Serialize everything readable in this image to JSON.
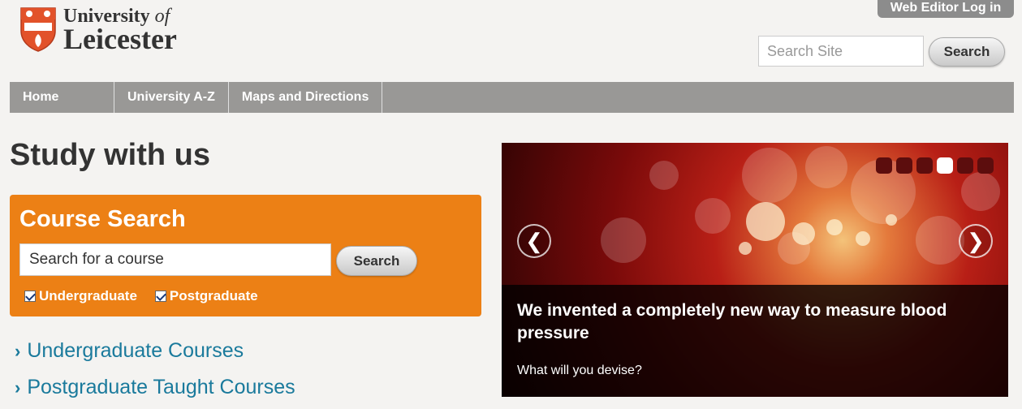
{
  "header": {
    "logo_line1": "University",
    "logo_of": "of",
    "logo_line2": "Leicester",
    "editor_login": "Web Editor Log in",
    "search_placeholder": "Search Site",
    "search_button": "Search"
  },
  "nav": {
    "items": [
      {
        "label": "Home"
      },
      {
        "label": "University A-Z"
      },
      {
        "label": "Maps and Directions"
      }
    ]
  },
  "main": {
    "title": "Study with us",
    "course_search": {
      "title": "Course Search",
      "input_value": "Search for a course",
      "button": "Search",
      "options": [
        {
          "label": "Undergraduate",
          "checked": true
        },
        {
          "label": "Postgraduate",
          "checked": true
        }
      ]
    },
    "links": [
      {
        "label": "Undergraduate Courses"
      },
      {
        "label": "Postgraduate Taught Courses"
      }
    ]
  },
  "carousel": {
    "headline": "We invented a completely new way to measure blood pressure",
    "subtext": "What will you devise?",
    "prev_glyph": "❮",
    "next_glyph": "❯",
    "slide_count": 6,
    "active_index": 3
  },
  "colors": {
    "accent": "#ec8015",
    "nav": "#999896",
    "link": "#1a7a9c",
    "shield": "#e2522a"
  }
}
